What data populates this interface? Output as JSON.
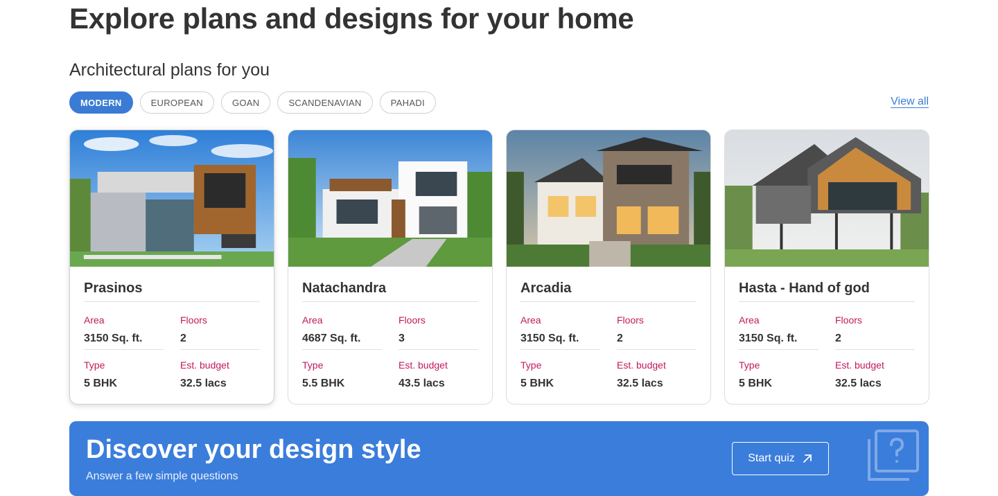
{
  "page": {
    "title": "Explore plans and designs for your home",
    "section_title": "Architectural plans for you",
    "view_all": "View all"
  },
  "filters": [
    {
      "label": "MODERN",
      "active": true
    },
    {
      "label": "EUROPEAN",
      "active": false
    },
    {
      "label": "GOAN",
      "active": false
    },
    {
      "label": "SCANDENAVIAN",
      "active": false
    },
    {
      "label": "PAHADI",
      "active": false
    }
  ],
  "labels": {
    "area": "Area",
    "floors": "Floors",
    "type": "Type",
    "budget": "Est. budget"
  },
  "plans": [
    {
      "name": "Prasinos",
      "area": "3150 Sq. ft.",
      "floors": "2",
      "type": "5 BHK",
      "budget": "32.5 lacs",
      "image": "house-photo"
    },
    {
      "name": "Natachandra",
      "area": "4687 Sq. ft.",
      "floors": "3",
      "type": "5.5 BHK",
      "budget": "43.5 lacs",
      "image": "house-photo"
    },
    {
      "name": "Arcadia",
      "area": "3150 Sq. ft.",
      "floors": "2",
      "type": "5 BHK",
      "budget": "32.5 lacs",
      "image": "house-photo"
    },
    {
      "name": "Hasta - Hand of god",
      "area": "3150 Sq. ft.",
      "floors": "2",
      "type": "5 BHK",
      "budget": "32.5 lacs",
      "image": "house-photo"
    }
  ],
  "banner": {
    "title": "Discover your design style",
    "subtitle": "Answer a few simple questions",
    "button": "Start quiz",
    "button_icon": "arrow-up-right-icon",
    "deco_icon": "question-card-icon"
  },
  "colors": {
    "accent": "#3a7bd5",
    "label": "#c2185b",
    "banner": "#3b7ddb"
  }
}
